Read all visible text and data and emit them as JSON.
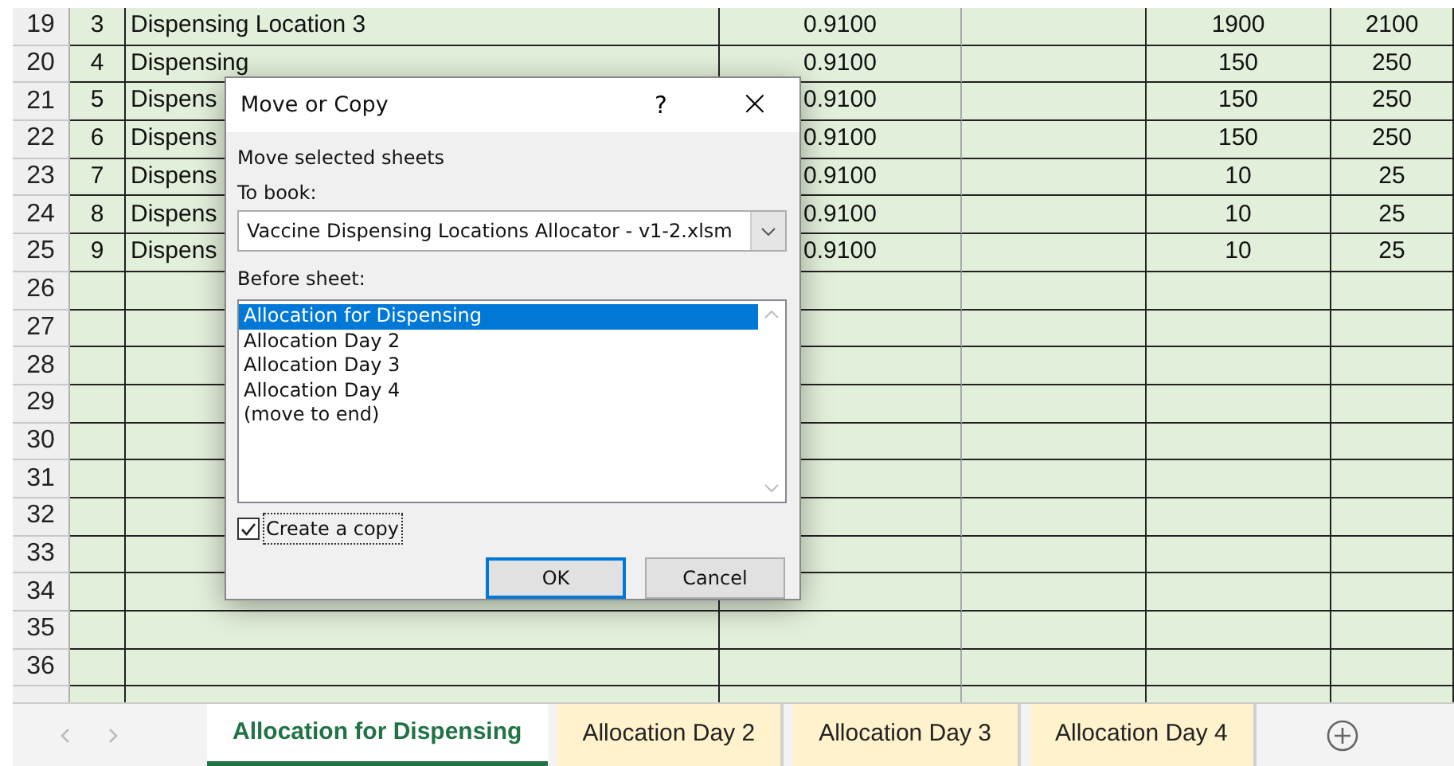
{
  "sheet": {
    "rows": [
      {
        "row_number": "19",
        "cells": [
          "3",
          "Dispensing Location 3",
          "0.9100",
          "",
          "1900",
          "2100"
        ]
      },
      {
        "row_number": "20",
        "cells": [
          "4",
          "Dispensing",
          "0.9100",
          "",
          "150",
          "250"
        ]
      },
      {
        "row_number": "21",
        "cells": [
          "5",
          "Dispens",
          "0.9100",
          "",
          "150",
          "250"
        ]
      },
      {
        "row_number": "22",
        "cells": [
          "6",
          "Dispens",
          "0.9100",
          "",
          "150",
          "250"
        ]
      },
      {
        "row_number": "23",
        "cells": [
          "7",
          "Dispens",
          "0.9100",
          "",
          "10",
          "25"
        ]
      },
      {
        "row_number": "24",
        "cells": [
          "8",
          "Dispens",
          "0.9100",
          "",
          "10",
          "25"
        ]
      },
      {
        "row_number": "25",
        "cells": [
          "9",
          "Dispens",
          "0.9100",
          "",
          "10",
          "25"
        ]
      },
      {
        "row_number": "26",
        "cells": [
          "",
          "",
          "",
          "",
          "",
          ""
        ]
      },
      {
        "row_number": "27",
        "cells": [
          "",
          "",
          "",
          "",
          "",
          ""
        ]
      },
      {
        "row_number": "28",
        "cells": [
          "",
          "",
          "",
          "",
          "",
          ""
        ]
      },
      {
        "row_number": "29",
        "cells": [
          "",
          "",
          "",
          "",
          "",
          ""
        ]
      },
      {
        "row_number": "30",
        "cells": [
          "",
          "",
          "",
          "",
          "",
          ""
        ]
      },
      {
        "row_number": "31",
        "cells": [
          "",
          "",
          "",
          "",
          "",
          ""
        ]
      },
      {
        "row_number": "32",
        "cells": [
          "",
          "",
          "",
          "",
          "",
          ""
        ]
      },
      {
        "row_number": "33",
        "cells": [
          "",
          "",
          "",
          "",
          "",
          ""
        ]
      },
      {
        "row_number": "34",
        "cells": [
          "",
          "",
          "",
          "",
          "",
          ""
        ]
      },
      {
        "row_number": "35",
        "cells": [
          "",
          "",
          "",
          "",
          "",
          ""
        ]
      },
      {
        "row_number": "36",
        "cells": [
          "",
          "",
          "",
          "",
          "",
          ""
        ]
      }
    ]
  },
  "dialog": {
    "title": "Move or Copy",
    "help": "?",
    "close": "×",
    "intro": "Move selected sheets",
    "to_book_label": "To book:",
    "to_book_value": "Vaccine Dispensing Locations Allocator - v1-2.xlsm",
    "before_label": "Before sheet:",
    "sheets": [
      {
        "label": "Allocation for Dispensing",
        "selected": true
      },
      {
        "label": "Allocation Day 2",
        "selected": false
      },
      {
        "label": "Allocation Day 3",
        "selected": false
      },
      {
        "label": "Allocation Day 4",
        "selected": false
      },
      {
        "label": "(move to end)",
        "selected": false
      }
    ],
    "create_copy": {
      "label": "Create a copy",
      "checked": true
    },
    "buttons": [
      {
        "label": "OK",
        "default": true
      },
      {
        "label": "Cancel",
        "default": false
      }
    ]
  },
  "tabs": [
    {
      "label": "Allocation for Dispensing",
      "selected": true
    },
    {
      "label": "Allocation Day 2",
      "selected": false
    },
    {
      "label": "Allocation Day 3",
      "selected": false
    },
    {
      "label": "Allocation Day 4",
      "selected": false
    }
  ]
}
